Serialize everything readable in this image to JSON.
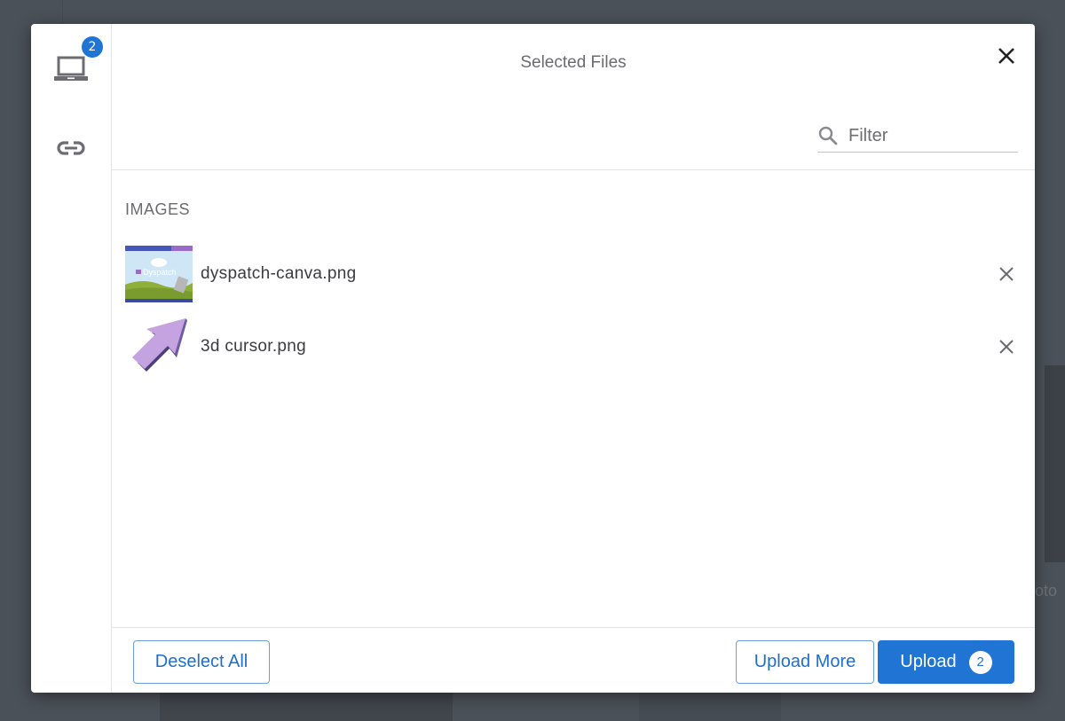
{
  "dialog": {
    "title": "Selected Files",
    "close_icon": "close-icon"
  },
  "sidebar": {
    "items": [
      {
        "name": "my-device",
        "icon": "laptop-icon",
        "badge": "2",
        "active": true
      },
      {
        "name": "link",
        "icon": "link-icon"
      }
    ]
  },
  "filter": {
    "placeholder": "Filter",
    "value": "",
    "icon": "search-icon"
  },
  "sections": [
    {
      "label": "IMAGES",
      "files": [
        {
          "name": "dyspatch-canva.png",
          "thumb": "dyspatch-banner-thumbnail",
          "thumb_text": "Dyspatch"
        },
        {
          "name": "3d cursor.png",
          "thumb": "purple-3d-cursor-thumbnail"
        }
      ]
    }
  ],
  "footer": {
    "deselect_label": "Deselect All",
    "upload_more_label": "Upload More",
    "upload_label": "Upload",
    "upload_count": "2"
  },
  "background": {
    "partial_text": "oto"
  },
  "colors": {
    "accent": "#1f74d4",
    "overlay": "#4b5159",
    "text_muted": "#6b6b6f"
  }
}
